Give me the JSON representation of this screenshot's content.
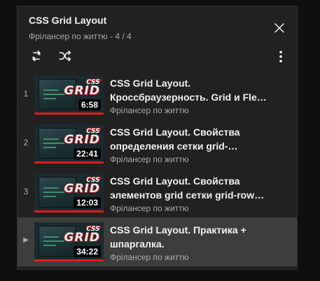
{
  "playlist": {
    "title": "CSS Grid Layout",
    "subtitle": "Фрілансер по життю - 4 / 4",
    "controls": {
      "close_icon": "close-icon",
      "loop_icon": "loop-icon",
      "shuffle_icon": "shuffle-icon",
      "more_icon": "more-vertical-icon"
    },
    "accent_color": "#e11b1b",
    "items": [
      {
        "index": "1",
        "title": "CSS Grid Layout. Кроссбраузерность. Grid и Fle…",
        "channel": "Фрілансер по життю",
        "duration": "6:58",
        "thumb_badge": "CSS",
        "thumb_word": "GRID"
      },
      {
        "index": "2",
        "title": "CSS Grid Layout. Свойства определения сетки grid-…",
        "channel": "Фрілансер по життю",
        "duration": "22:41",
        "thumb_badge": "CSS",
        "thumb_word": "GRID"
      },
      {
        "index": "3",
        "title": "CSS Grid Layout. Свойства элементов grid сетки grid-row…",
        "channel": "Фрілансер по життю",
        "duration": "12:03",
        "thumb_badge": "CSS",
        "thumb_word": "GRID"
      },
      {
        "index": "▶",
        "title": "CSS Grid Layout. Практика + шпаргалка.",
        "channel": "Фрілансер по життю",
        "duration": "34:22",
        "thumb_badge": "CSS",
        "thumb_word": "GRID",
        "active": true
      }
    ]
  }
}
